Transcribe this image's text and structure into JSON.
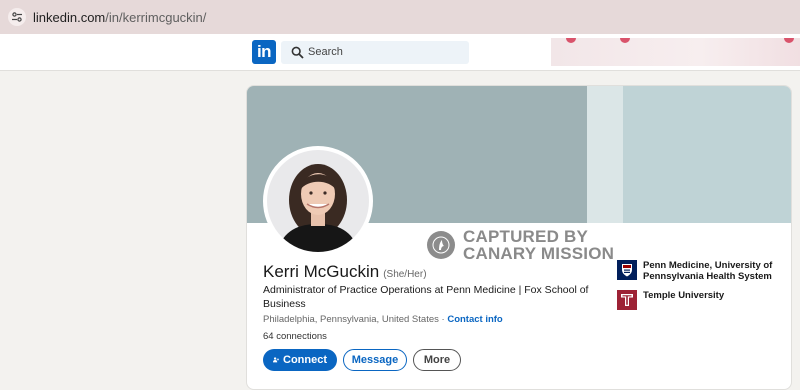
{
  "browser": {
    "url_host": "linkedin.com",
    "url_path": "/in/kerrimcguckin/"
  },
  "nav": {
    "logo_text": "in",
    "search_placeholder": "Search"
  },
  "watermark": {
    "line1": "CAPTURED BY",
    "line2": "CANARY MISSION"
  },
  "profile": {
    "name": "Kerri McGuckin",
    "pronouns": "(She/Her)",
    "headline": "Administrator of Practice Operations at Penn Medicine | Fox School of Business",
    "location": "Philadelphia, Pennsylvania, United States",
    "separator": "·",
    "contact_info": "Contact info",
    "connections": "64 connections"
  },
  "actions": {
    "connect": "Connect",
    "message": "Message",
    "more": "More"
  },
  "organizations": [
    {
      "name": "Penn Medicine, University of Pennsylvania Health System",
      "logo": "penn-shield"
    },
    {
      "name": "Temple University",
      "logo": "temple-t"
    }
  ],
  "colors": {
    "linkedin_blue": "#0a66c2",
    "banner_light": "#bfd3d6",
    "banner_dark": "#9fb2b5",
    "penn_navy": "#011f5b",
    "temple_cherry": "#9d2235"
  }
}
